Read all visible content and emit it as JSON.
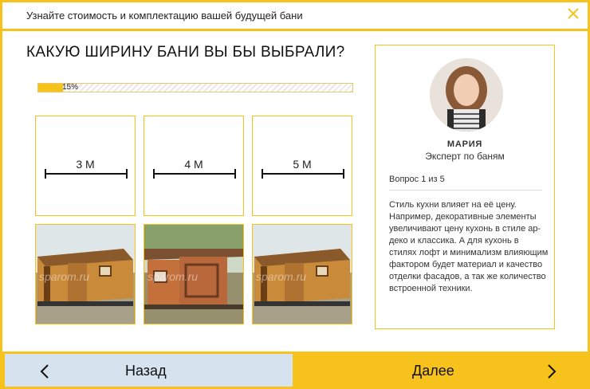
{
  "header": {
    "title": "Узнайте стоимость и комплектацию вашей будущей бани"
  },
  "question": {
    "title": "КАКУЮ ШИРИНУ БАНИ ВЫ БЫ ВЫБРАЛИ?"
  },
  "progress": {
    "value": 0.15,
    "label": "15%"
  },
  "options": [
    {
      "label": "3 М"
    },
    {
      "label": "4 М"
    },
    {
      "label": "5 М"
    }
  ],
  "photos": {
    "watermark": "sparom.ru"
  },
  "expert": {
    "name": "МАРИЯ",
    "role": "Эксперт по баням",
    "question_counter": "Вопрос 1 из 5",
    "text": "Стиль кухни влияет на её цену. Например, декоративные элементы увеличивают цену кухонь в стиле ар-деко и классика. А для кухонь в стилях лофт и минимализм влияющим фактором будет материал и качество отделки фасадов, а так же количество встроенной техники."
  },
  "nav": {
    "back_label": "Назад",
    "next_label": "Далее"
  },
  "colors": {
    "accent": "#f7c21c",
    "back_bg": "#d6e2ee"
  }
}
